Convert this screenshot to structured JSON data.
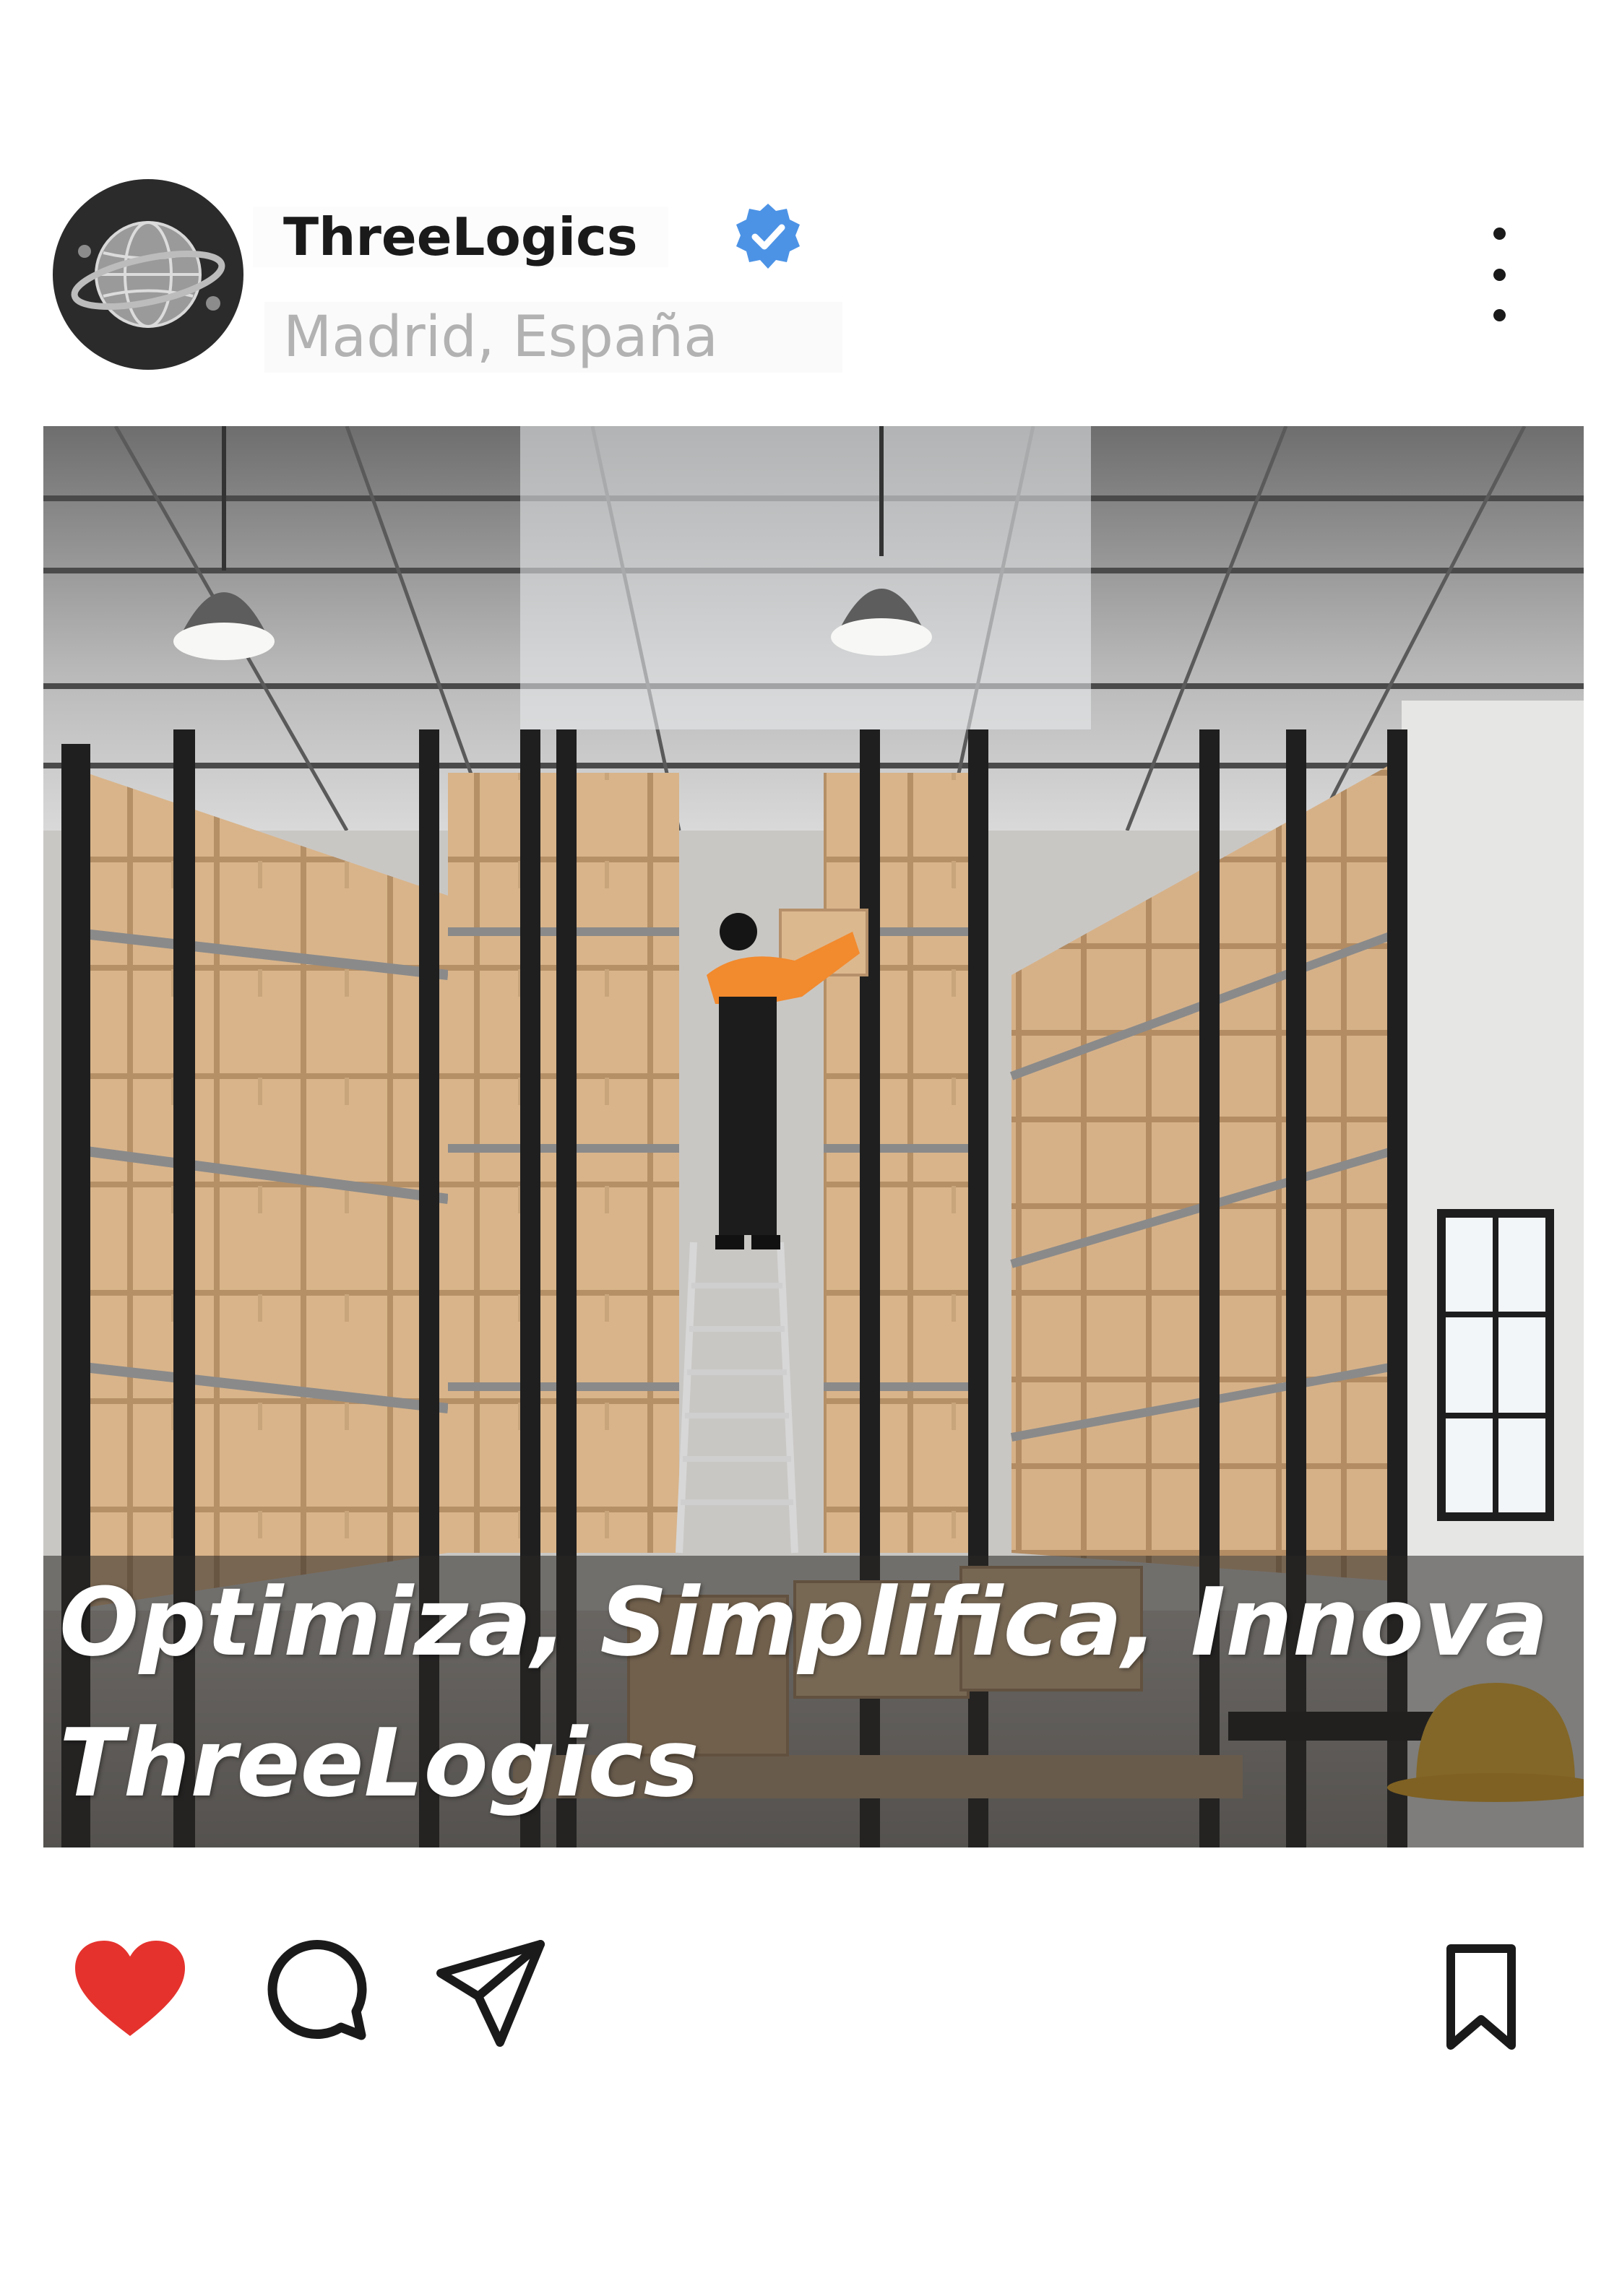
{
  "post": {
    "username": "ThreeLogics",
    "verified": true,
    "location": "Madrid, España",
    "caption_line1": "Optimiza, Simplifica, Innova",
    "caption_line2": "ThreeLogics",
    "liked": true
  },
  "icons": {
    "avatar": "globe-logo-icon",
    "verified": "verified-badge-icon",
    "more": "more-vertical-icon",
    "like": "heart-icon",
    "comment": "comment-icon",
    "share": "send-icon",
    "save": "bookmark-icon"
  },
  "colors": {
    "like": "#e5322d",
    "verified": "#4c93e6",
    "text_primary": "#1a1a1a",
    "text_secondary": "#b2b2b2"
  }
}
